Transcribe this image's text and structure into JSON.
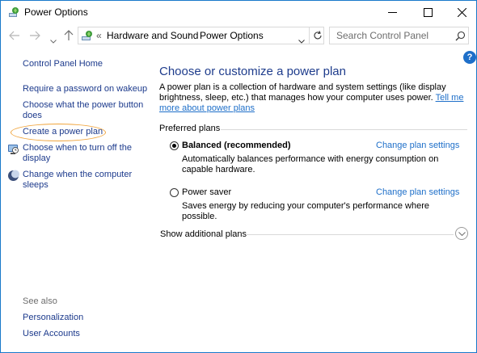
{
  "window": {
    "title": "Power Options"
  },
  "address": {
    "chevrons": "«",
    "crumbs": [
      "Hardware and Sound",
      "Power Options"
    ],
    "separator": "›"
  },
  "search": {
    "placeholder": "Search Control Panel"
  },
  "help": {
    "label": "?"
  },
  "sidebar": {
    "home": "Control Panel Home",
    "links": [
      "Require a password on wakeup",
      "Choose what the power button does",
      "Create a power plan",
      "Choose when to turn off the display",
      "Change when the computer sleeps"
    ],
    "see_also_label": "See also",
    "see_also": [
      "Personalization",
      "User Accounts"
    ]
  },
  "main": {
    "heading": "Choose or customize a power plan",
    "description": "A power plan is a collection of hardware and system settings (like display brightness, sleep, etc.) that manages how your computer uses power.",
    "learn_more": "Tell me more about power plans",
    "preferred_label": "Preferred plans",
    "plans": [
      {
        "name": "Balanced (recommended)",
        "description": "Automatically balances performance with energy consumption on capable hardware.",
        "change_label": "Change plan settings",
        "selected": true
      },
      {
        "name": "Power saver",
        "description": "Saves energy by reducing your computer's performance where possible.",
        "change_label": "Change plan settings",
        "selected": false
      }
    ],
    "show_additional": "Show additional plans"
  },
  "colors": {
    "link": "#1c3a8c",
    "accent_link": "#1e6fc9",
    "heading": "#1e3c8c",
    "highlight": "#f0a33a"
  }
}
